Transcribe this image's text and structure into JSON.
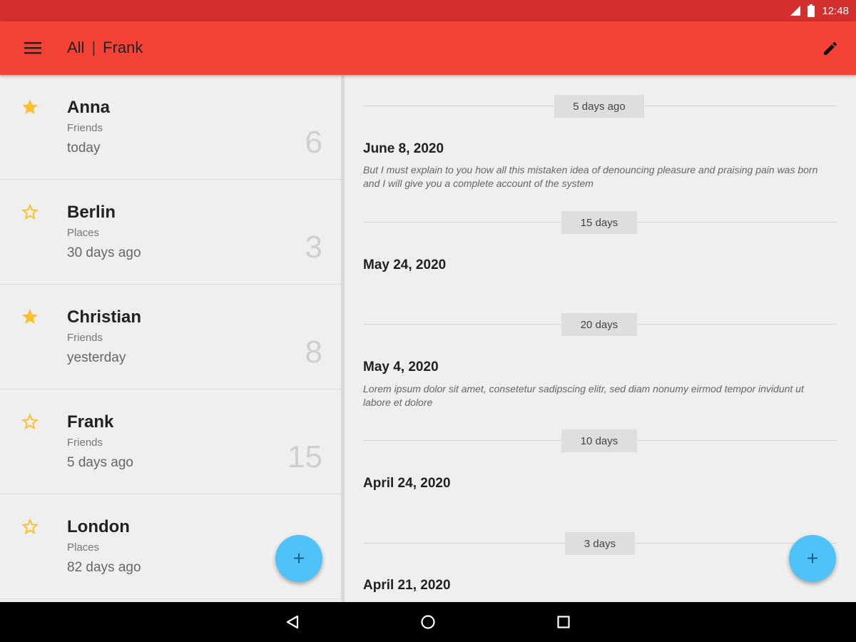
{
  "status_bar": {
    "time": "12:48"
  },
  "app_bar": {
    "title_all": "All",
    "title_separator": "|",
    "title_name": "Frank",
    "menu_icon": "menu-icon",
    "edit_icon": "pencil-icon"
  },
  "contacts": [
    {
      "name": "Anna",
      "group": "Friends",
      "ago": "today",
      "count": "6",
      "starred": true
    },
    {
      "name": "Berlin",
      "group": "Places",
      "ago": "30 days ago",
      "count": "3",
      "starred": false
    },
    {
      "name": "Christian",
      "group": "Friends",
      "ago": "yesterday",
      "count": "8",
      "starred": true
    },
    {
      "name": "Frank",
      "group": "Friends",
      "ago": "5 days ago",
      "count": "15",
      "starred": false
    },
    {
      "name": "London",
      "group": "Places",
      "ago": "82 days ago",
      "count": "",
      "starred": false
    }
  ],
  "timeline": {
    "gaps": [
      "5 days ago",
      "15 days",
      "20 days",
      "10 days",
      "3 days"
    ],
    "entries": [
      {
        "date": "June 8, 2020",
        "note": "But I must explain to you how all this mistaken idea of denouncing pleasure and praising pain was born and I will give you a complete account of the system"
      },
      {
        "date": "May 24, 2020",
        "note": ""
      },
      {
        "date": "May 4, 2020",
        "note": "Lorem ipsum dolor sit amet, consetetur sadipscing elitr, sed diam nonumy eirmod tempor invidunt ut labore et dolore"
      },
      {
        "date": "April 24, 2020",
        "note": ""
      },
      {
        "date": "April 21, 2020",
        "note": ""
      }
    ]
  },
  "fab": {
    "symbol": "+"
  },
  "colors": {
    "status_bar": "#d32f2f",
    "app_bar": "#f44336",
    "star": "#fbc02d",
    "fab": "#4fc3f7"
  }
}
